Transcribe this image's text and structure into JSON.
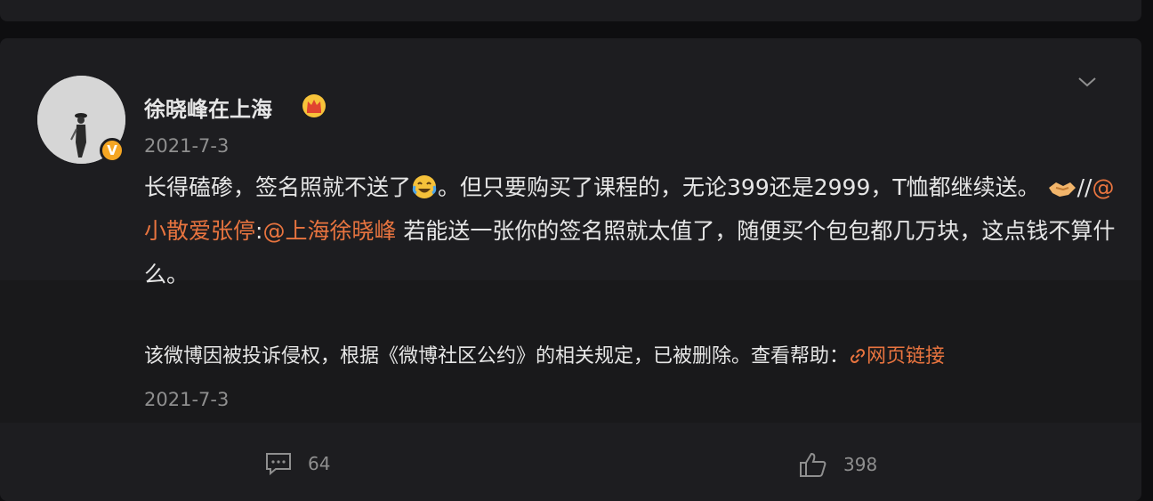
{
  "post": {
    "username": "徐晓峰在上海",
    "date": "2021-7-3",
    "text_part1": "长得磕碜，签名照就不送了",
    "text_part2": "。但只要购买了课程的，无论399还是2999，T恤都继续送。",
    "text_separator": "//",
    "mention1": "@小散爱张停",
    "colon": ":",
    "mention2": "@上海徐晓峰",
    "text_part3": " 若能送一张你的签名照就太值了，随便买个包包都几万块，这点钱不算什么。"
  },
  "retweet": {
    "notice": "该微博因被投诉侵权，根据《微博社区公约》的相关规定，已被删除。查看帮助：",
    "link_label": "网页链接",
    "date": "2021-7-3"
  },
  "actions": {
    "comments": "64",
    "likes": "398"
  },
  "colors": {
    "accent": "#e8743f",
    "verified_badge": "#f5a623"
  },
  "icons": [
    "crown-icon",
    "chevron-down-icon",
    "laugh-cry-emoji-icon",
    "handshake-emoji-icon",
    "link-icon",
    "comment-icon",
    "like-icon",
    "verified-badge-icon"
  ]
}
